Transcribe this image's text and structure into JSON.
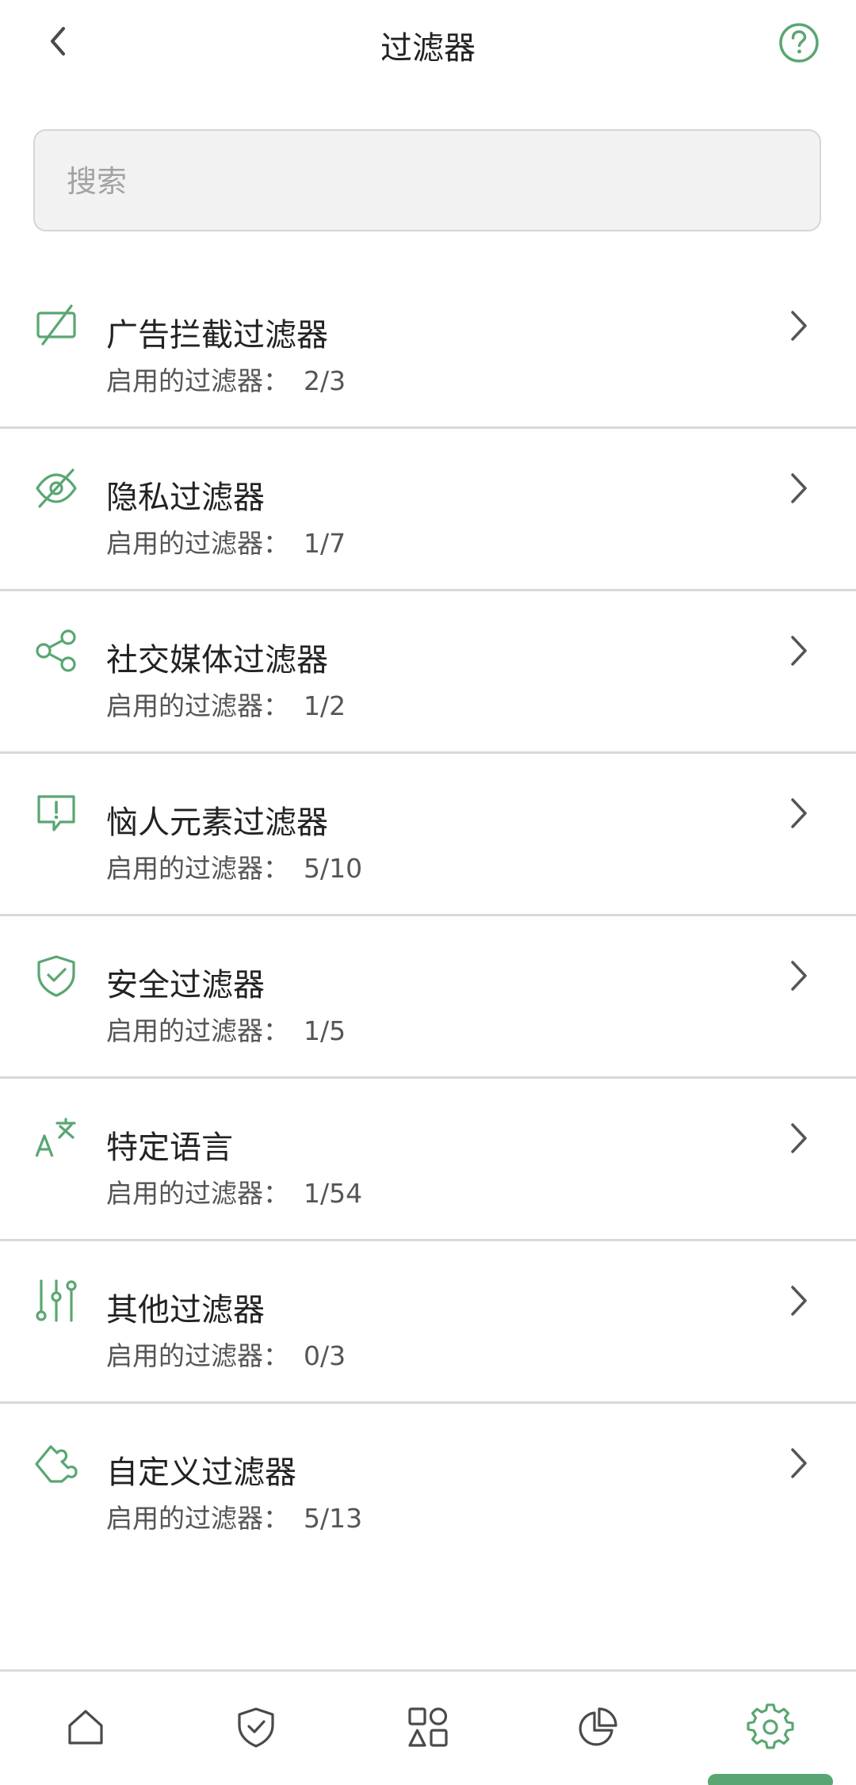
{
  "header": {
    "title": "过滤器"
  },
  "search": {
    "placeholder": "搜索",
    "value": ""
  },
  "colors": {
    "accent": "#5aa672",
    "icon_gray": "#4a4a4a",
    "divider": "#d9d9d9"
  },
  "list": {
    "items": [
      {
        "icon": "ad-block-icon",
        "title": "广告拦截过滤器",
        "sub_label": "启用的过滤器：",
        "count": "2/3"
      },
      {
        "icon": "eye-off-icon",
        "title": "隐私过滤器",
        "sub_label": "启用的过滤器：",
        "count": "1/7"
      },
      {
        "icon": "share-icon",
        "title": "社交媒体过滤器",
        "sub_label": "启用的过滤器：",
        "count": "1/2"
      },
      {
        "icon": "message-alert-icon",
        "title": "恼人元素过滤器",
        "sub_label": "启用的过滤器：",
        "count": "5/10"
      },
      {
        "icon": "shield-check-icon",
        "title": "安全过滤器",
        "sub_label": "启用的过滤器：",
        "count": "1/5"
      },
      {
        "icon": "translate-icon",
        "title": "特定语言",
        "sub_label": "启用的过滤器：",
        "count": "1/54"
      },
      {
        "icon": "sliders-icon",
        "title": "其他过滤器",
        "sub_label": "启用的过滤器：",
        "count": "0/3"
      },
      {
        "icon": "puzzle-icon",
        "title": "自定义过滤器",
        "sub_label": "启用的过滤器：",
        "count": "5/13"
      }
    ]
  },
  "bottom_nav": {
    "items": [
      {
        "icon": "home-icon",
        "active": false
      },
      {
        "icon": "shield-check-icon",
        "active": false
      },
      {
        "icon": "apps-icon",
        "active": false
      },
      {
        "icon": "pie-chart-icon",
        "active": false
      },
      {
        "icon": "gear-icon",
        "active": true
      }
    ]
  }
}
